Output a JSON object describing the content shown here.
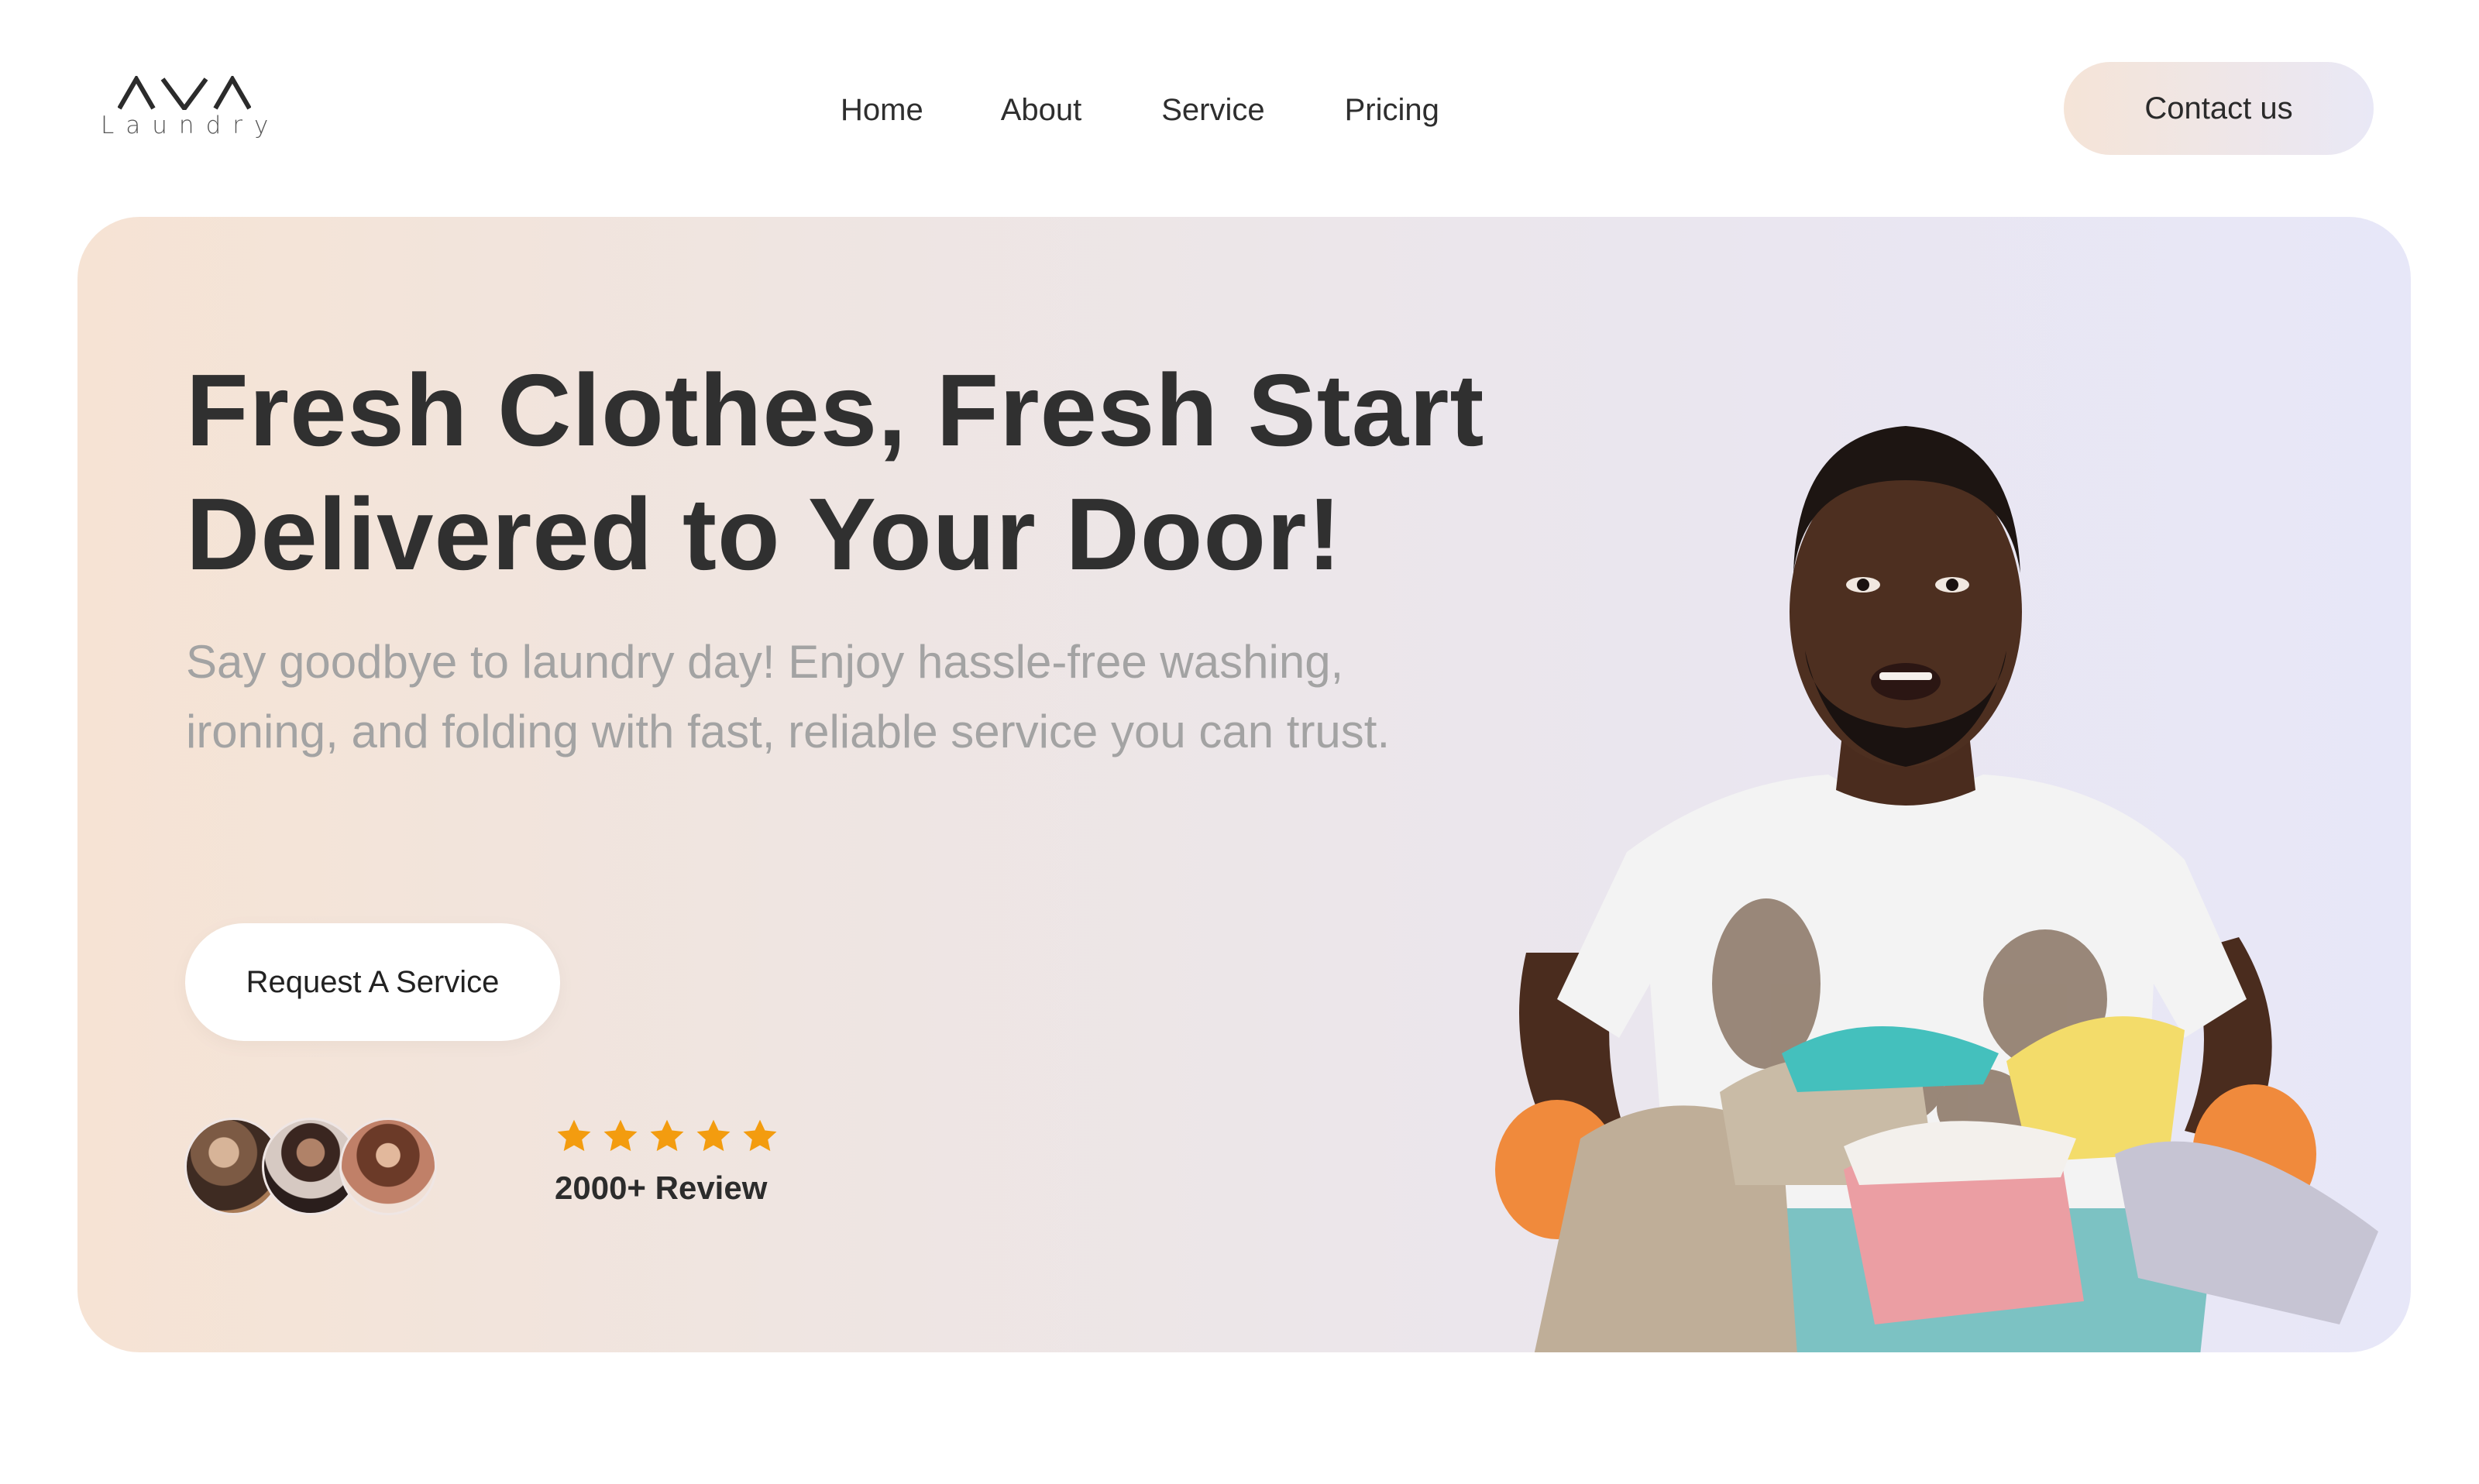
{
  "brand": {
    "logo_text": "Laundry"
  },
  "nav": {
    "items": [
      {
        "label": "Home"
      },
      {
        "label": "About"
      },
      {
        "label": "Service"
      },
      {
        "label": "Pricing"
      }
    ],
    "contact_label": "Contact us"
  },
  "hero": {
    "headline_line1": "Fresh Clothes, Fresh Start",
    "headline_line2": "Delivered to Your Door!",
    "subtext": "Say goodbye to laundry day! Enjoy hassle-free washing, ironing, and folding with fast, reliable service you can trust.",
    "cta_label": "Request  A Service",
    "rating_stars": 5,
    "review_label": "2000+ Review"
  },
  "colors": {
    "star": "#f39c0f",
    "text_dark": "#2f2f2f",
    "text_muted": "#a3a3a3",
    "gradient_start": "#f6e3d4",
    "gradient_end": "#e7e7f8"
  },
  "icons": {
    "logo": "ava-logo-icon",
    "star": "star-icon"
  }
}
